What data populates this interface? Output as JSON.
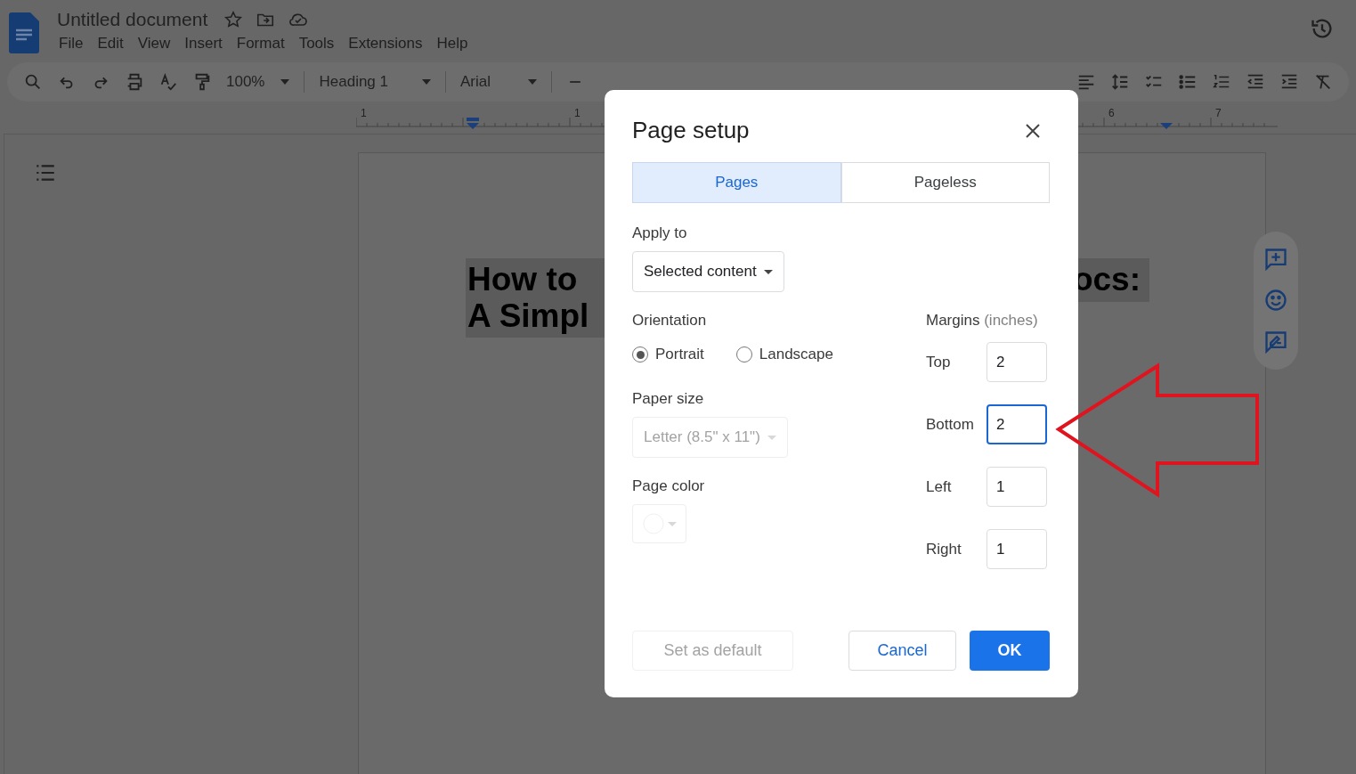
{
  "app": {
    "title": "Untitled document",
    "menus": [
      "File",
      "Edit",
      "View",
      "Insert",
      "Format",
      "Tools",
      "Extensions",
      "Help"
    ]
  },
  "toolbar": {
    "zoom": "100%",
    "style": "Heading 1",
    "font": "Arial"
  },
  "ruler": {
    "labels": [
      "1",
      "1",
      "6",
      "7"
    ]
  },
  "document": {
    "heading_left": [
      "How to",
      "A Simpl"
    ],
    "heading_right": [
      "ocs:"
    ]
  },
  "dialog": {
    "title": "Page setup",
    "tabs": [
      {
        "label": "Pages",
        "selected": true
      },
      {
        "label": "Pageless",
        "selected": false
      }
    ],
    "apply_to": {
      "label": "Apply to",
      "value": "Selected content"
    },
    "orientation": {
      "label": "Orientation",
      "options": [
        {
          "label": "Portrait",
          "selected": true
        },
        {
          "label": "Landscape",
          "selected": false
        }
      ]
    },
    "paper_size": {
      "label": "Paper size",
      "value": "Letter (8.5\" x 11\")",
      "disabled": true
    },
    "page_color": {
      "label": "Page color",
      "disabled": true
    },
    "margins": {
      "label": "Margins",
      "unit": "(inches)",
      "fields": [
        {
          "label": "Top",
          "value": "2",
          "focused": false
        },
        {
          "label": "Bottom",
          "value": "2",
          "focused": true
        },
        {
          "label": "Left",
          "value": "1",
          "focused": false
        },
        {
          "label": "Right",
          "value": "1",
          "focused": false
        }
      ]
    },
    "buttons": [
      {
        "label": "Set as default",
        "kind": "text",
        "disabled": true
      },
      {
        "label": "Cancel",
        "kind": "outlined",
        "disabled": false
      },
      {
        "label": "OK",
        "kind": "primary",
        "disabled": false
      }
    ]
  }
}
